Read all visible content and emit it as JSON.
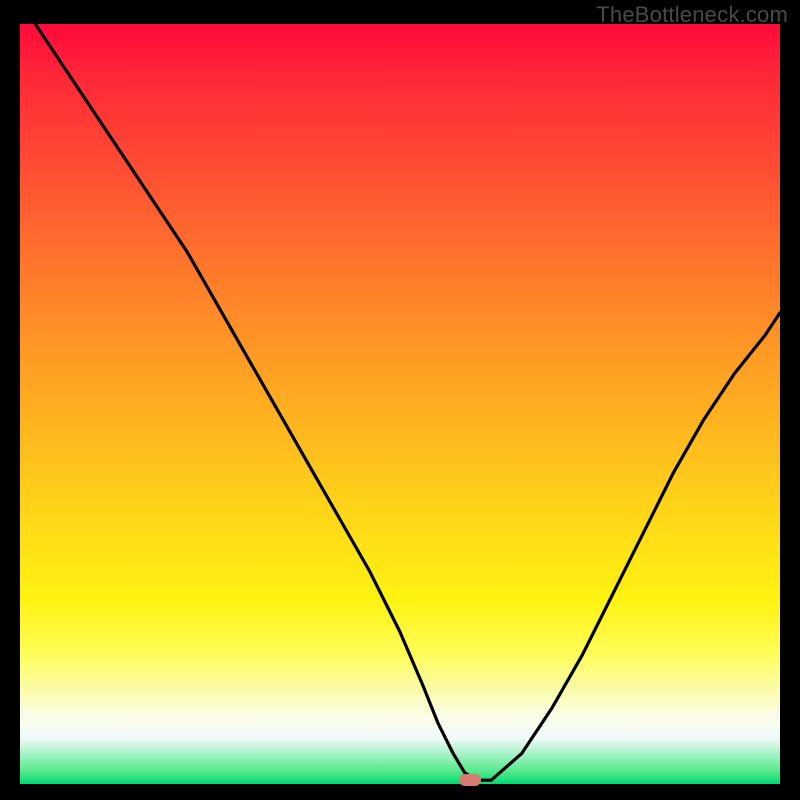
{
  "watermark": "TheBottleneck.com",
  "colors": {
    "frame_bg": "#000000",
    "curve_stroke": "#000000",
    "marker_fill": "#d77b71"
  },
  "chart_data": {
    "type": "line",
    "title": "",
    "xlabel": "",
    "ylabel": "",
    "xlim": [
      0,
      100
    ],
    "ylim": [
      0,
      100
    ],
    "grid": false,
    "annotations": [
      {
        "text": "TheBottleneck.com",
        "position": "top-right"
      }
    ],
    "series": [
      {
        "name": "curve",
        "x": [
          2,
          6,
          10,
          14,
          18,
          22,
          26,
          30,
          34,
          38,
          42,
          46,
          50,
          53,
          55,
          57,
          58.5,
          60,
          62,
          66,
          70,
          74,
          78,
          82,
          86,
          90,
          94,
          98,
          100
        ],
        "y": [
          100,
          94,
          88,
          82,
          76,
          70,
          63,
          56,
          49,
          42,
          35,
          28,
          20,
          13,
          8,
          4,
          1.5,
          0.5,
          0.5,
          4,
          10,
          17,
          25,
          33,
          41,
          48,
          54,
          59,
          62
        ]
      }
    ],
    "marker": {
      "x": 59.2,
      "y": 0.5
    }
  }
}
